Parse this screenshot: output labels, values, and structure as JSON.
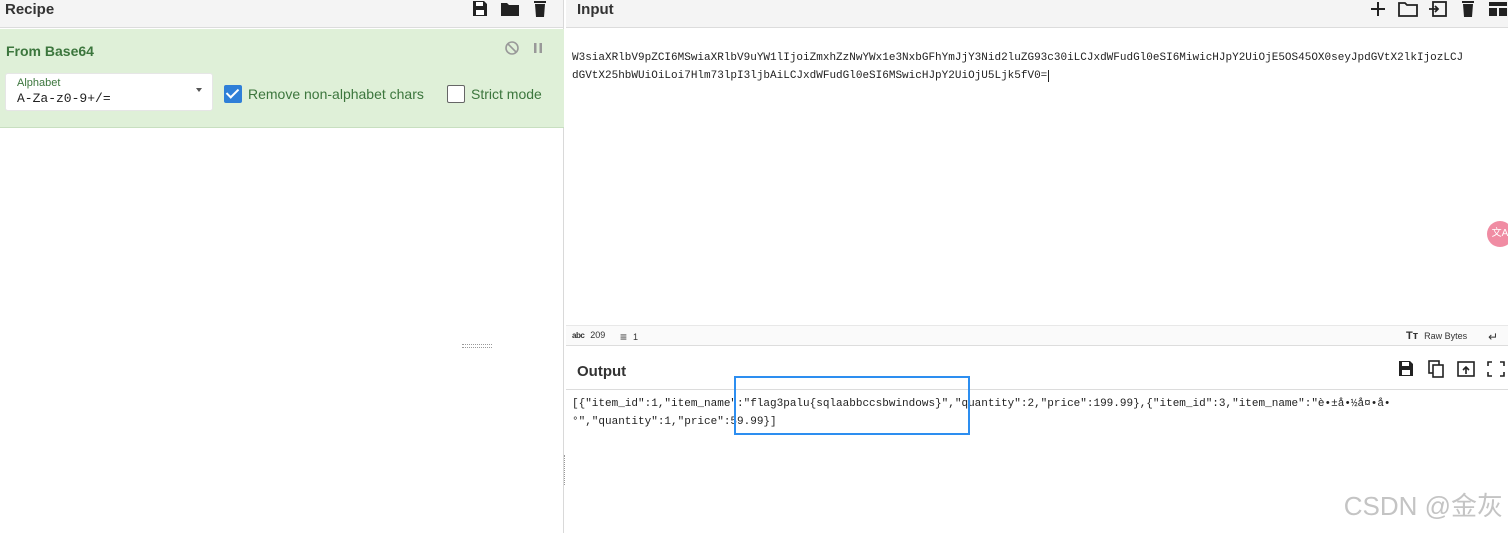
{
  "recipe": {
    "title": "Recipe",
    "operation": {
      "title": "From Base64",
      "alphabet_label": "Alphabet",
      "alphabet_value": "A-Za-z0-9+/=",
      "remove_non_alphabet_label": "Remove non-alphabet chars",
      "remove_non_alphabet_checked": true,
      "strict_mode_label": "Strict mode",
      "strict_mode_checked": false
    }
  },
  "input": {
    "title": "Input",
    "lines": [
      "W3siaXRlbV9pZCI6MSwiaXRlbV9uYW1lIjoiZmxhZzNwYWx1e3NxbGFhYmJjY3Nid2luZG93c30iLCJxdWFudGl0eSI6MiwicHJpY2UiOjE5OS45OX0seyJpdGVtX2lkIjozLCJ",
      "dGVtX25hbWUiOiLoi7Hlm73lpI3ljbAiLCJxdWFudGl0eSI6MSwicHJpY2UiOjU5Ljk5fV0="
    ],
    "status": {
      "chars_icon": "abc",
      "chars": "209",
      "lines": "1",
      "raw_bytes": "Raw Bytes"
    }
  },
  "output": {
    "title": "Output",
    "lines": [
      "[{\"item_id\":1,\"item_name\":\"flag3palu{sqlaabbccsbwindows}\",\"quantity\":2,\"price\":199.99},{\"item_id\":3,\"item_name\":\"è•±å•½å¤•å•",
      "°\",\"quantity\":1,\"price\":59.99}]"
    ]
  },
  "watermark": "CSDN @金灰",
  "colors": {
    "accent": "#2f7fd8",
    "op_bg": "#dff0d8",
    "op_text": "#3c763d",
    "highlight": "#2d8ef0"
  }
}
